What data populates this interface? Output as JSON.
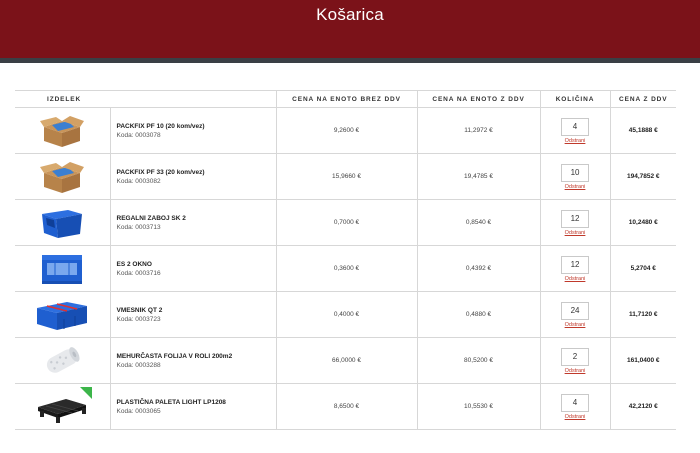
{
  "page": {
    "title": "Košarica"
  },
  "table": {
    "headers": {
      "product": "IZDELEK",
      "price_net": "CENA NA ENOTO BREZ DDV",
      "price_gross": "CENA NA ENOTO Z DDV",
      "quantity": "KOLIČINA",
      "total": "CENA Z DDV"
    },
    "remove_label": "Odstrani",
    "rows": [
      {
        "name": "PACKFIX PF 10 (20 kom/vez)",
        "code": "Koda: 0003078",
        "price_net": "9,2600 €",
        "price_gross": "11,2972 €",
        "qty": "4",
        "total": "45,1888 €",
        "image": "cardboard-box-icon"
      },
      {
        "name": "PACKFIX PF 33 (20 kom/vez)",
        "code": "Koda: 0003082",
        "price_net": "15,9660 €",
        "price_gross": "19,4785 €",
        "qty": "10",
        "total": "194,7852 €",
        "image": "cardboard-box-icon"
      },
      {
        "name": "REGALNI ZABOJ SK 2",
        "code": "Koda: 0003713",
        "price_net": "0,7000 €",
        "price_gross": "0,8540 €",
        "qty": "12",
        "total": "10,2480 €",
        "image": "blue-bin-icon"
      },
      {
        "name": "ES 2 OKNO",
        "code": "Koda: 0003716",
        "price_net": "0,3600 €",
        "price_gross": "0,4392 €",
        "qty": "12",
        "total": "5,2704 €",
        "image": "blue-window-bin-icon"
      },
      {
        "name": "VMESNIK QT 2",
        "code": "Koda: 0003723",
        "price_net": "0,4000 €",
        "price_gross": "0,4880 €",
        "qty": "24",
        "total": "11,7120 €",
        "image": "blue-divider-tray-icon"
      },
      {
        "name": "MEHURČASTA FOLIJA V ROLI 200m2",
        "code": "Koda: 0003288",
        "price_net": "66,0000 €",
        "price_gross": "80,5200 €",
        "qty": "2",
        "total": "161,0400 €",
        "image": "bubble-wrap-roll-icon"
      },
      {
        "name": "PLASTIČNA PALETA LIGHT LP1208",
        "code": "Koda: 0003065",
        "price_net": "8,6500 €",
        "price_gross": "10,5530 €",
        "qty": "4",
        "total": "42,2120 €",
        "image": "plastic-pallet-icon"
      }
    ]
  },
  "colors": {
    "header": "#7b1219",
    "stripe": "#3a3f45",
    "remove_link": "#c0392b",
    "bin_blue": "#1f5fd0"
  }
}
